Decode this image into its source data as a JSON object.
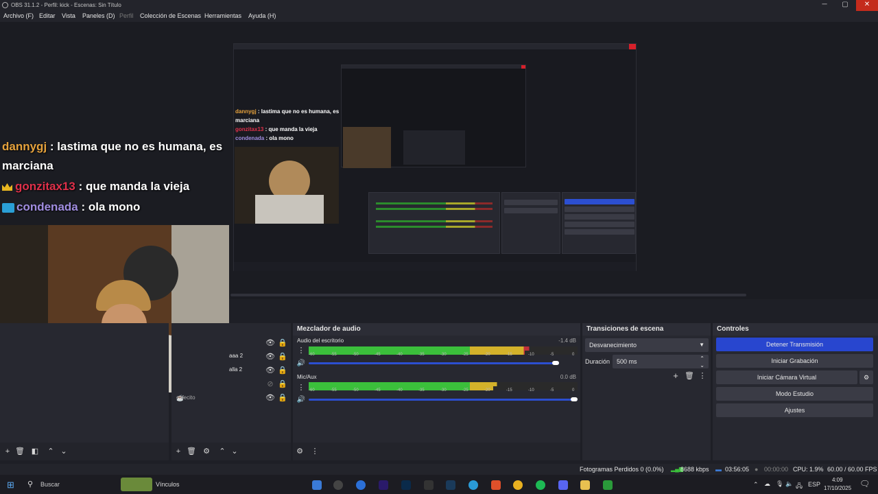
{
  "window": {
    "title": "OBS 31.1.2 - Perfil: kick - Escenas: Sin Título",
    "minimize": "─",
    "maximize": "▢",
    "close": "✕"
  },
  "menu": [
    "Archivo (F)",
    "Editar",
    "Vista",
    "Paneles (D)",
    "Perfil",
    "Colección de Escenas",
    "Herramientas",
    "Ayuda (H)"
  ],
  "chat": [
    {
      "user": "dannygj",
      "sep": " : ",
      "text": "lastima que no es humana, es marciana"
    },
    {
      "user": "gonzitax13",
      "sep": " : ",
      "text": "que manda la vieja"
    },
    {
      "user": "condenada",
      "sep": " : ",
      "text": "ola mono"
    }
  ],
  "sources": {
    "items": [
      {
        "label": "aaa 2"
      },
      {
        "label": "alla 2"
      },
      {
        "label": "cafecito"
      }
    ]
  },
  "mixer": {
    "title": "Mezclador de audio",
    "channels": [
      {
        "name": "Audio del escritorio",
        "db": "-1.4 dB",
        "level": 0.82,
        "volume": 0.93
      },
      {
        "name": "Mic/Aux",
        "db": "0.0 dB",
        "level": 0.7,
        "volume": 1.0
      }
    ],
    "scale": [
      "-60",
      "-55",
      "-50",
      "-45",
      "-40",
      "-35",
      "-30",
      "-25",
      "-20",
      "-15",
      "-10",
      "-5",
      "0"
    ]
  },
  "transitions": {
    "title": "Transiciones de escena",
    "selected": "Desvanecimiento",
    "duration_label": "Duración",
    "duration_value": "500 ms"
  },
  "controls": {
    "title": "Controles",
    "buttons": [
      "Detener Transmisión",
      "Iniciar Grabación",
      "Iniciar Cámara Virtual",
      "Modo Estudio",
      "Ajustes"
    ]
  },
  "status": {
    "dropped": "Fotogramas Perdidos 0 (0.0%)",
    "bitrate": "8688 kbps",
    "stream_time": "03:56:05",
    "rec_time": "00:00:00",
    "cpu": "CPU: 1.9%",
    "fps": "60.00 / 60.00 FPS"
  },
  "taskbar": {
    "search": "Buscar",
    "widget": "Vínculos",
    "lang": "ESP",
    "time": "4:09",
    "date": "17/10/2025"
  },
  "colors": {
    "accent": "#2846cf",
    "close": "#d6202a",
    "meter_green": "#3bbf3b",
    "meter_yellow": "#d4b22a",
    "meter_red": "#c0303a"
  }
}
